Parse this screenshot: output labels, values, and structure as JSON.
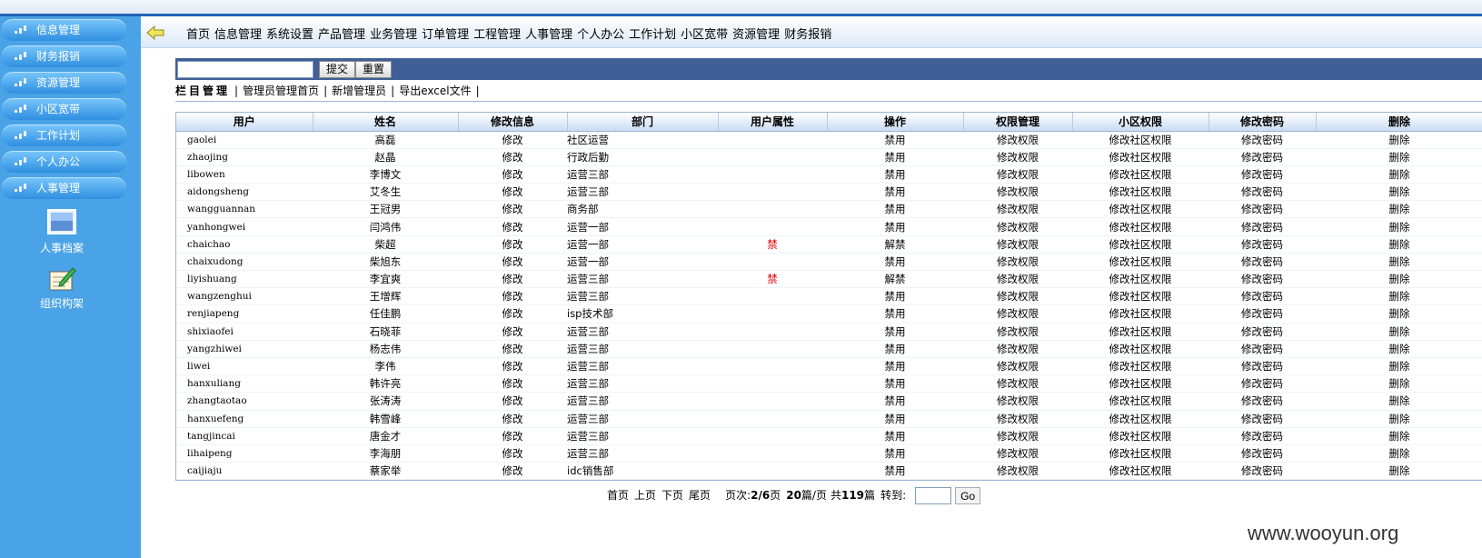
{
  "sidebar": {
    "menu": [
      "信息管理",
      "财务报销",
      "资源管理",
      "小区宽带",
      "工作计划",
      "个人办公",
      "人事管理"
    ],
    "tools": [
      {
        "label": "人事档案",
        "icon": "monitor-icon"
      },
      {
        "label": "组织构架",
        "icon": "notepad-pen-icon"
      }
    ]
  },
  "nav": {
    "items": [
      "首页",
      "信息管理",
      "系统设置",
      "产品管理",
      "业务管理",
      "订单管理",
      "工程管理",
      "人事管理",
      "个人办公",
      "工作计划",
      "小区宽带",
      "资源管理",
      "财务报销"
    ]
  },
  "toolbar": {
    "search_value": "",
    "submit_label": "提交",
    "reset_label": "重置"
  },
  "crumbs": {
    "title": "栏目管理",
    "links": [
      "管理员管理首页",
      "新增管理员",
      "导出excel文件"
    ]
  },
  "table": {
    "headers": [
      "用户",
      "姓名",
      "修改信息",
      "部门",
      "用户属性",
      "操作",
      "权限管理",
      "小区权限",
      "修改密码",
      "删除"
    ],
    "rows": [
      [
        "gaolei",
        "高磊",
        "修改",
        "社区运营",
        "",
        "禁用",
        "修改权限",
        "修改社区权限",
        "修改密码",
        "删除"
      ],
      [
        "zhaojing",
        "赵晶",
        "修改",
        "行政后勤",
        "",
        "禁用",
        "修改权限",
        "修改社区权限",
        "修改密码",
        "删除"
      ],
      [
        "libowen",
        "李博文",
        "修改",
        "运营三部",
        "",
        "禁用",
        "修改权限",
        "修改社区权限",
        "修改密码",
        "删除"
      ],
      [
        "aidongsheng",
        "艾冬生",
        "修改",
        "运营三部",
        "",
        "禁用",
        "修改权限",
        "修改社区权限",
        "修改密码",
        "删除"
      ],
      [
        "wangguannan",
        "王冠男",
        "修改",
        "商务部",
        "",
        "禁用",
        "修改权限",
        "修改社区权限",
        "修改密码",
        "删除"
      ],
      [
        "yanhongwei",
        "闫鸿伟",
        "修改",
        "运营一部",
        "",
        "禁用",
        "修改权限",
        "修改社区权限",
        "修改密码",
        "删除"
      ],
      [
        "chaichao",
        "柴超",
        "修改",
        "运营一部",
        "禁",
        "解禁",
        "修改权限",
        "修改社区权限",
        "修改密码",
        "删除"
      ],
      [
        "chaixudong",
        "柴旭东",
        "修改",
        "运营一部",
        "",
        "禁用",
        "修改权限",
        "修改社区权限",
        "修改密码",
        "删除"
      ],
      [
        "liyishuang",
        "李宜爽",
        "修改",
        "运营三部",
        "禁",
        "解禁",
        "修改权限",
        "修改社区权限",
        "修改密码",
        "删除"
      ],
      [
        "wangzenghui",
        "王增辉",
        "修改",
        "运营三部",
        "",
        "禁用",
        "修改权限",
        "修改社区权限",
        "修改密码",
        "删除"
      ],
      [
        "renjiapeng",
        "任佳鹏",
        "修改",
        "isp技术部",
        "",
        "禁用",
        "修改权限",
        "修改社区权限",
        "修改密码",
        "删除"
      ],
      [
        "shixiaofei",
        "石晓菲",
        "修改",
        "运营三部",
        "",
        "禁用",
        "修改权限",
        "修改社区权限",
        "修改密码",
        "删除"
      ],
      [
        "yangzhiwei",
        "杨志伟",
        "修改",
        "运营三部",
        "",
        "禁用",
        "修改权限",
        "修改社区权限",
        "修改密码",
        "删除"
      ],
      [
        "liwei",
        "李伟",
        "修改",
        "运营三部",
        "",
        "禁用",
        "修改权限",
        "修改社区权限",
        "修改密码",
        "删除"
      ],
      [
        "hanxuliang",
        "韩许亮",
        "修改",
        "运营三部",
        "",
        "禁用",
        "修改权限",
        "修改社区权限",
        "修改密码",
        "删除"
      ],
      [
        "zhangtaotao",
        "张涛涛",
        "修改",
        "运营三部",
        "",
        "禁用",
        "修改权限",
        "修改社区权限",
        "修改密码",
        "删除"
      ],
      [
        "hanxuefeng",
        "韩雪峰",
        "修改",
        "运营三部",
        "",
        "禁用",
        "修改权限",
        "修改社区权限",
        "修改密码",
        "删除"
      ],
      [
        "tangjincai",
        "唐金才",
        "修改",
        "运营三部",
        "",
        "禁用",
        "修改权限",
        "修改社区权限",
        "修改密码",
        "删除"
      ],
      [
        "lihaipeng",
        "李海朋",
        "修改",
        "运营三部",
        "",
        "禁用",
        "修改权限",
        "修改社区权限",
        "修改密码",
        "删除"
      ],
      [
        "caijiaju",
        "蔡家举",
        "修改",
        "idc销售部",
        "",
        "禁用",
        "修改权限",
        "修改社区权限",
        "修改密码",
        "删除"
      ]
    ]
  },
  "pager": {
    "first": "首页",
    "prev": "上页",
    "next": "下页",
    "last": "尾页",
    "page_label": "页次:",
    "page_info": "2/6",
    "page_unit": "页",
    "per_page": "20",
    "per_page_unit": "篇/页",
    "total_label": "共",
    "total": "119",
    "total_unit": "篇",
    "goto_label": "转到:",
    "goto_value": "",
    "go_label": "Go"
  },
  "watermark": "www.wooyun.org",
  "colors": {
    "sidebar": "#4aa3e6",
    "toolbar": "#3f5f96",
    "accent": "#1f63b5",
    "warning": "#e00000"
  }
}
